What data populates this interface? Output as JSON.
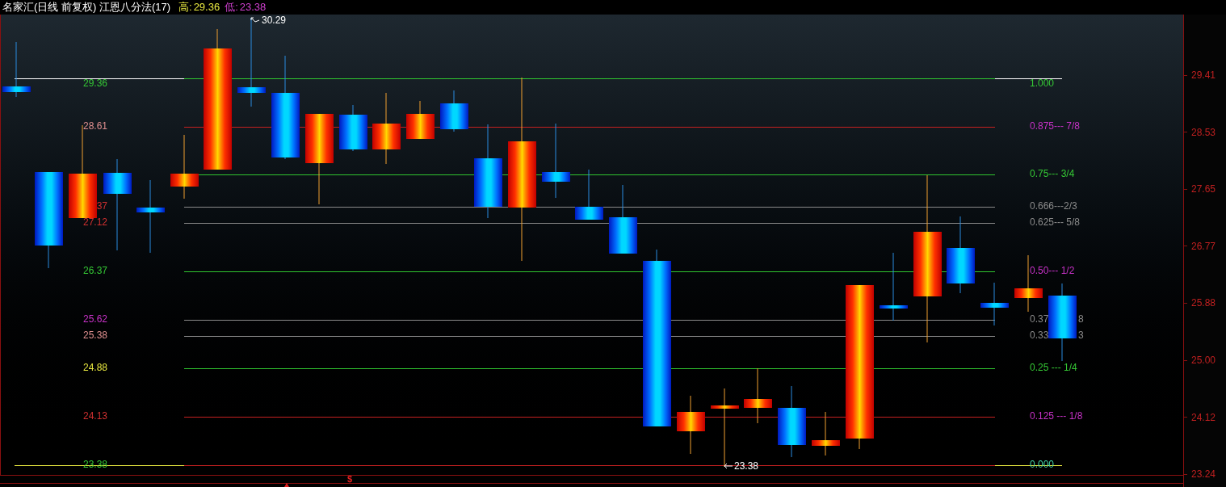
{
  "header": {
    "title": "名家汇(日线 前复权) 江恩八分法(17)",
    "high": {
      "label": "高:",
      "value": "29.36"
    },
    "low": {
      "label": "低:",
      "value": "23.38"
    }
  },
  "levels": [
    {
      "line": {
        "color": "#2fc52f"
      },
      "extension": {
        "color": "#ffffff"
      },
      "price": {
        "text": "29.36",
        "color": "#35c835"
      },
      "ratio": {
        "parts": [
          "1.000"
        ],
        "color": "#35c835"
      }
    },
    {
      "line": {
        "color": "#c42020"
      },
      "price": {
        "text": "28.61",
        "color": "#e09090"
      },
      "ratio": {
        "parts": [
          "0.875--- 7/8"
        ],
        "color": "#c832c8"
      }
    },
    {
      "line": {
        "color": "#2fc52f"
      },
      "ratio": {
        "parts": [
          "0.75--- 3/4"
        ],
        "color": "#35c835"
      }
    },
    {
      "line": {
        "color": "#8a8a8a"
      },
      "price": {
        "text": "37",
        "color": "#d03030"
      },
      "ratio": {
        "parts": [
          "0.666---2/3"
        ],
        "color": "#8c8c8c"
      }
    },
    {
      "line": {
        "color": "#8a8a8a"
      },
      "price": {
        "text": "27.12",
        "color": "#d03030"
      },
      "ratio": {
        "parts": [
          "0.625--- 5/8"
        ],
        "color": "#8c8c8c"
      }
    },
    {
      "line": {
        "color": "#2fc52f"
      },
      "price": {
        "text": "26.37",
        "color": "#35c835"
      },
      "ratio": {
        "parts": [
          "0.50--- 1/2"
        ],
        "color": "#c832c8"
      }
    },
    {
      "line": {
        "color": "#8a8a8a"
      },
      "price": {
        "text": "25.62",
        "color": "#c832c8"
      },
      "ratio": {
        "parts": [
          "0.37",
          "8"
        ],
        "color": "#8c8c8c"
      }
    },
    {
      "line": {
        "color": "#8a8a8a"
      },
      "price": {
        "text": "25.38",
        "color": "#e09090"
      },
      "ratio": {
        "parts": [
          "0.33",
          "3"
        ],
        "color": "#8c8c8c"
      }
    },
    {
      "line": {
        "color": "#2fc52f"
      },
      "price": {
        "text": "24.88",
        "color": "#e8e840"
      },
      "ratio": {
        "parts": [
          "0.25 --- 1/4"
        ],
        "color": "#35c835"
      }
    },
    {
      "line": {
        "color": "#c42020"
      },
      "price": {
        "text": "24.13",
        "color": "#d03030"
      },
      "ratio": {
        "parts": [
          "0.125 --- 1/8"
        ],
        "color": "#c832c8"
      }
    },
    {
      "line": {
        "color": "#c42020"
      },
      "extension": {
        "color": "#e8e840"
      },
      "price": {
        "text": "23.38",
        "color": "#35c835"
      },
      "ratio": {
        "parts": [
          "0.000"
        ],
        "color": "#40d0a0"
      }
    }
  ],
  "high_marker": "30.29",
  "low_marker": "23.38",
  "signal_marker": "$",
  "axis_ticks": [
    "29.41",
    "28.53",
    "27.65",
    "26.77",
    "25.88",
    "25.00",
    "24.12",
    "23.24"
  ]
}
